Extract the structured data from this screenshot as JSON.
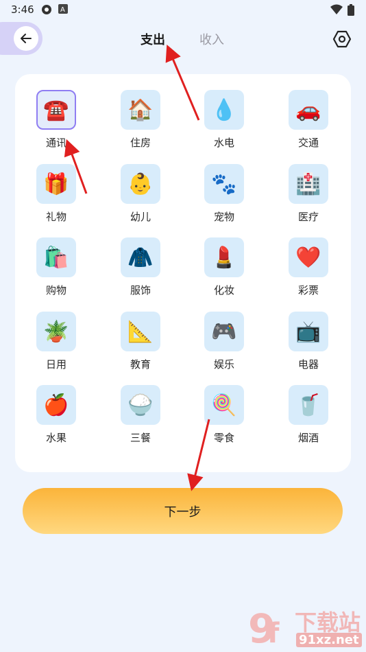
{
  "status_bar": {
    "time": "3:46"
  },
  "tabs": {
    "expense": "支出",
    "income": "收入"
  },
  "categories": [
    {
      "label": "通讯",
      "icon": "☎️"
    },
    {
      "label": "住房",
      "icon": "🏠"
    },
    {
      "label": "水电",
      "icon": "💧"
    },
    {
      "label": "交通",
      "icon": "🚗"
    },
    {
      "label": "礼物",
      "icon": "🎁"
    },
    {
      "label": "幼儿",
      "icon": "👶"
    },
    {
      "label": "宠物",
      "icon": "🐾"
    },
    {
      "label": "医疗",
      "icon": "🏥"
    },
    {
      "label": "购物",
      "icon": "🛍️"
    },
    {
      "label": "服饰",
      "icon": "🧥"
    },
    {
      "label": "化妆",
      "icon": "💄"
    },
    {
      "label": "彩票",
      "icon": "❤️"
    },
    {
      "label": "日用",
      "icon": "🪴"
    },
    {
      "label": "教育",
      "icon": "📐"
    },
    {
      "label": "娱乐",
      "icon": "🎮"
    },
    {
      "label": "电器",
      "icon": "📺"
    },
    {
      "label": "水果",
      "icon": "🍎"
    },
    {
      "label": "三餐",
      "icon": "🍚"
    },
    {
      "label": "零食",
      "icon": "🍭"
    },
    {
      "label": "烟酒",
      "icon": "🥤"
    }
  ],
  "selected_category": "通讯",
  "next_button": "下一步",
  "watermark": {
    "brand": "下载站",
    "site": "91xz.net"
  },
  "colors": {
    "accent": "#8f7df2",
    "annotation_arrow": "#e02020",
    "button": "#fbb43a"
  }
}
